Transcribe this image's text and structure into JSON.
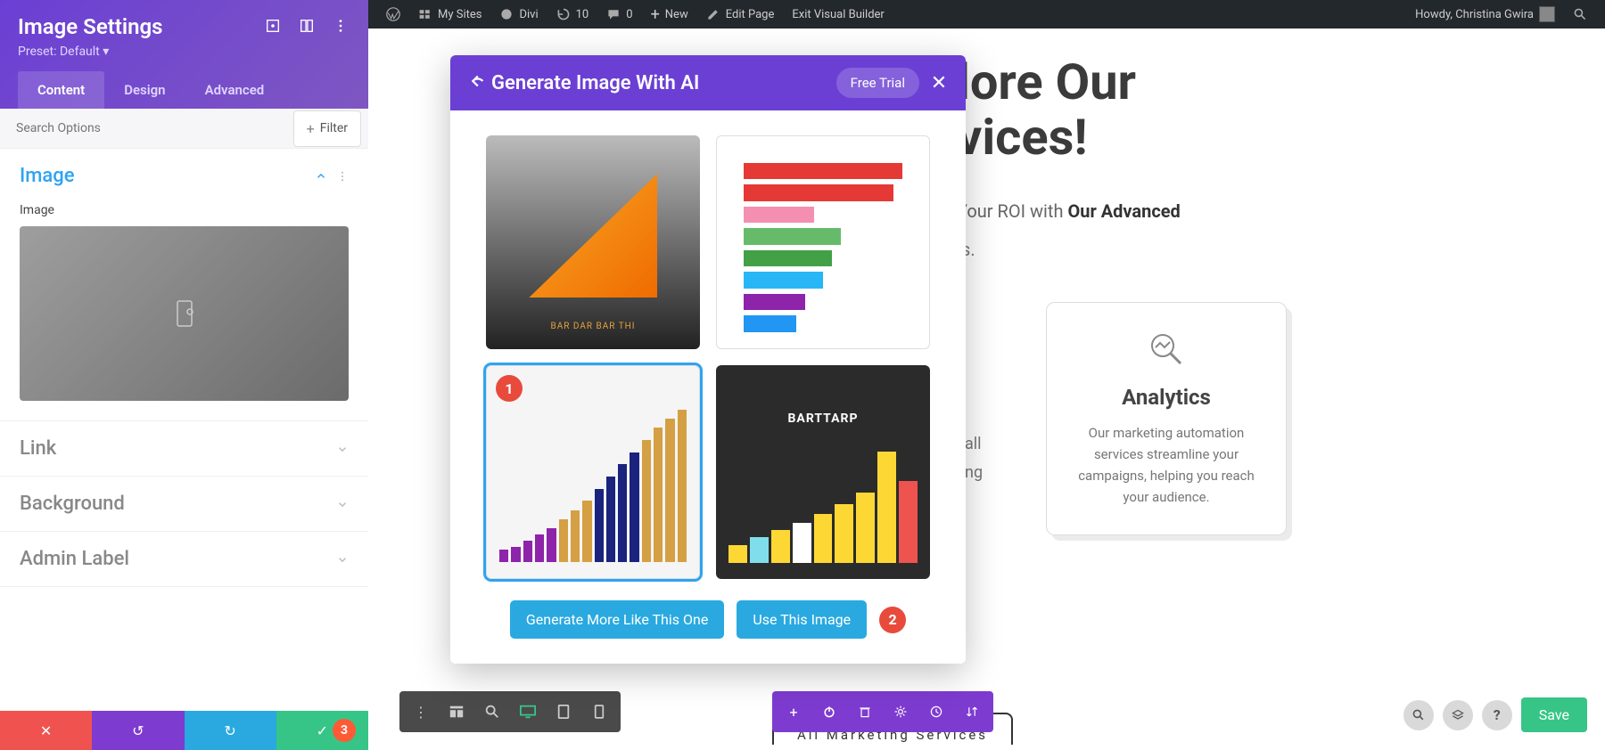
{
  "wp_bar": {
    "my_sites": "My Sites",
    "divi": "Divi",
    "updates": "10",
    "comments": "0",
    "new": "New",
    "edit_page": "Edit Page",
    "exit_vb": "Exit Visual Builder",
    "howdy": "Howdy, Christina Gwira"
  },
  "sidebar": {
    "title": "Image Settings",
    "preset": "Preset: Default",
    "tabs": {
      "content": "Content",
      "design": "Design",
      "advanced": "Advanced"
    },
    "search_placeholder": "Search Options",
    "filter": "Filter",
    "sections": {
      "image": {
        "title": "Image",
        "field_label": "Image"
      },
      "link": {
        "title": "Link"
      },
      "background": {
        "title": "Background"
      },
      "admin_label": {
        "title": "Admin Label"
      }
    },
    "footer_badge": "3"
  },
  "ai_modal": {
    "title": "Generate Image With AI",
    "free_trial": "Free Trial",
    "generate_more": "Generate More Like This One",
    "use_image": "Use This Image",
    "thumb_badges": {
      "selected": "1",
      "btn": "2"
    },
    "thumb4_label": "BARTTARP",
    "thumb1_label": "BAR DAR BAR THI"
  },
  "page": {
    "headline_a": "lore Our",
    "headline_b": "vices!",
    "roi_prefix": "Your ROI with ",
    "roi_bold": "Our Advanced",
    "s_dot": "s.",
    "all_txt": "all",
    "ng_txt": "ng",
    "card": {
      "title": "Analytics",
      "body": "Our marketing automation services streamline your campaigns, helping you reach your audience."
    },
    "all_marketing": "All Marketing Services"
  },
  "actions": {
    "save": "Save",
    "help": "?"
  }
}
